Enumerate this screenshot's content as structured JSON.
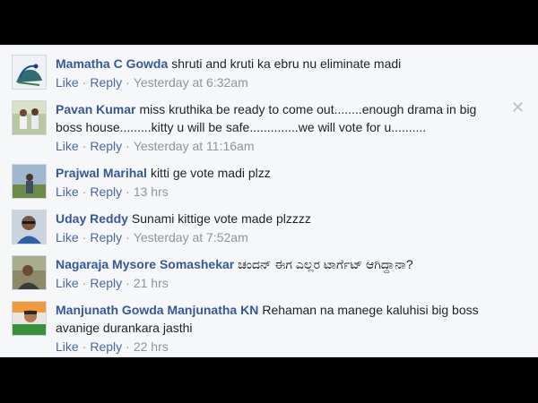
{
  "comments": [
    {
      "author": "Mamatha C Gowda",
      "text": "shruti and kruti ka ebru nu eliminate madi",
      "like": "Like",
      "reply": "Reply",
      "time": "Yesterday at 6:32am"
    },
    {
      "author": "Pavan Kumar",
      "text": "miss kruthika be ready to come out........enough drama in big boss house.........kitty u will be safe..............we will vote for u..........",
      "like": "Like",
      "reply": "Reply",
      "time": "Yesterday at 11:16am"
    },
    {
      "author": "Prajwal Marihal",
      "text": "kitti ge vote madi plzz",
      "like": "Like",
      "reply": "Reply",
      "time": "13 hrs"
    },
    {
      "author": "Uday Reddy",
      "text": "Sunami kittige vote made plzzzz",
      "like": "Like",
      "reply": "Reply",
      "time": "Yesterday at 7:52am"
    },
    {
      "author": "Nagaraja Mysore Somashekar",
      "text": "ಚಂದನ್ ಈಗ ಎಲ್ಲರ ಟಾರ್ಗೆಟ್ ಆಗಿದ್ದಾನಾ?",
      "like": "Like",
      "reply": "Reply",
      "time": "21 hrs"
    },
    {
      "author": "Manjunath Gowda Manjunatha KN",
      "text": "Rehaman na manege kaluhisi big boss avanige durankara jasthi",
      "like": "Like",
      "reply": "Reply",
      "time": "22 hrs"
    }
  ],
  "close_symbol": "✕",
  "colors": {
    "author": "#365899",
    "link": "#4b67a1",
    "meta": "#90949c",
    "background": "#f6f7f9"
  }
}
